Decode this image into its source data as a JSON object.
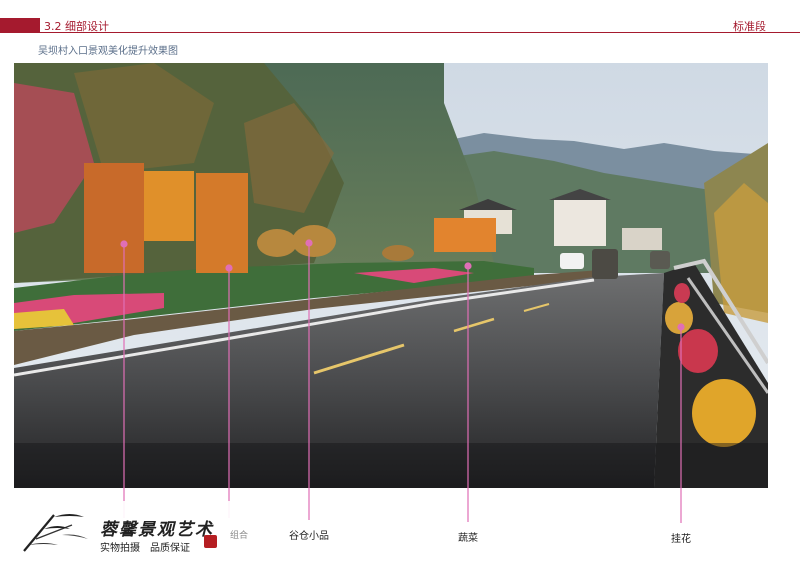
{
  "header": {
    "section_title": "3.2 细部设计",
    "corner_label": "标准段"
  },
  "subtitle": "吴坝村入口景观美化提升效果图",
  "callouts": {
    "granary": "谷仓小品",
    "vegetables": "蔬菜",
    "hanging_flowers": "挂花",
    "partial_label": "组合"
  },
  "watermark": {
    "title": "蓉馨景观艺术",
    "sub_1": "实物拍摄",
    "sub_2": "品质保证"
  },
  "colors": {
    "accent": "#a51a2e",
    "callout_line": "#e06fb6",
    "subtitle": "#5b6f8a"
  }
}
